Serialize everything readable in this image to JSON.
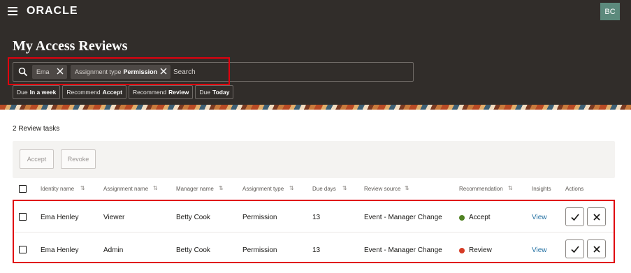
{
  "header": {
    "brand": "ORACLE",
    "avatar_initials": "BC",
    "page_title": "My Access Reviews"
  },
  "search": {
    "chips": [
      {
        "text": "Ema",
        "value": ""
      },
      {
        "text": "Assignment type",
        "value": "Permission"
      }
    ],
    "placeholder": "Search"
  },
  "quick_filters": [
    {
      "prefix": "Due",
      "value": "In a week"
    },
    {
      "prefix": "Recommend",
      "value": "Accept"
    },
    {
      "prefix": "Recommend",
      "value": "Review"
    },
    {
      "prefix": "Due",
      "value": "Today"
    }
  ],
  "results": {
    "count_label": "2 Review tasks",
    "toolbar": {
      "accept_label": "Accept",
      "revoke_label": "Revoke"
    }
  },
  "table": {
    "columns": [
      "Identity name",
      "Assignment name",
      "Manager name",
      "Assignment type",
      "Due days",
      "Review source",
      "Recommendation",
      "Insights",
      "Actions"
    ],
    "rows": [
      {
        "identity": "Ema Henley",
        "assignment": "Viewer",
        "manager": "Betty Cook",
        "type": "Permission",
        "due": "13",
        "source": "Event - Manager Change",
        "recommendation": "Accept",
        "rec_color": "#508223",
        "insights": "View"
      },
      {
        "identity": "Ema Henley",
        "assignment": "Admin",
        "manager": "Betty Cook",
        "type": "Permission",
        "due": "13",
        "source": "Event - Manager Change",
        "recommendation": "Review",
        "rec_color": "#d63b25",
        "insights": "View"
      }
    ]
  }
}
